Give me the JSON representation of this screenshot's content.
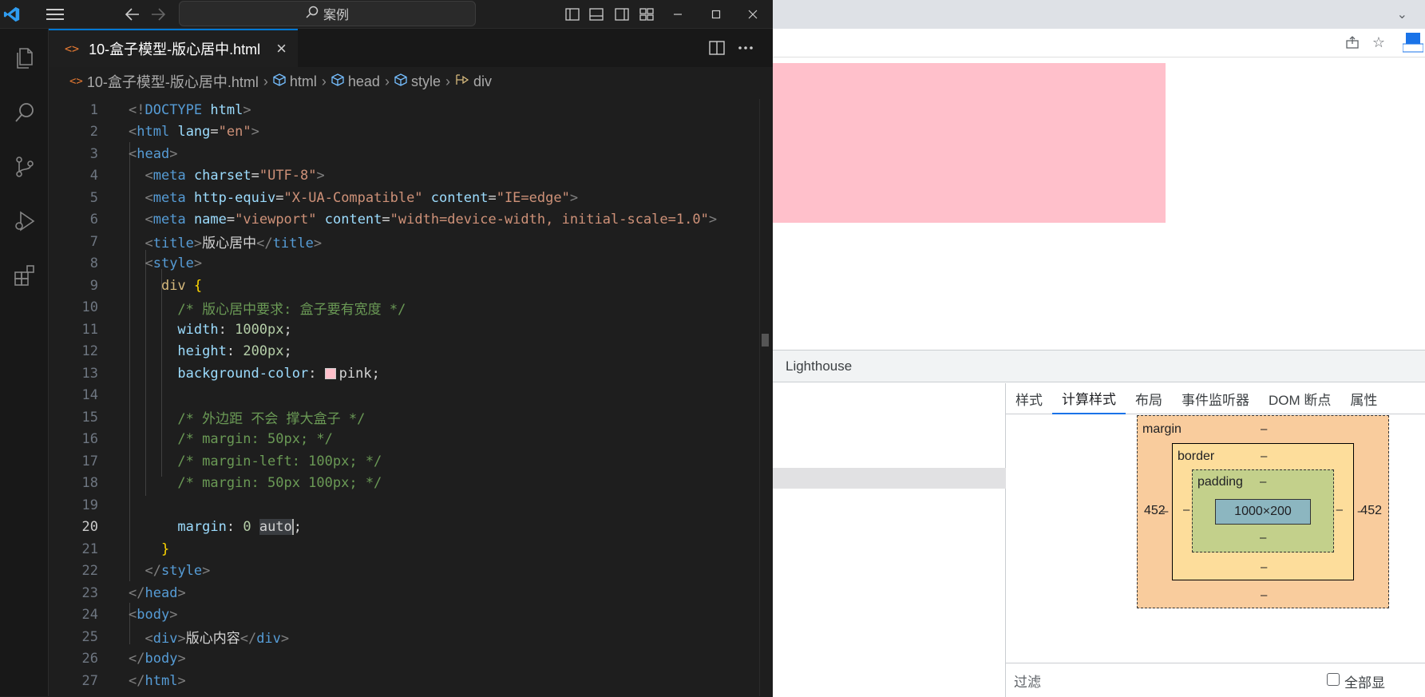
{
  "titlebar": {
    "search_label": "案例"
  },
  "editor": {
    "tab_title": "10-盒子模型-版心居中.html",
    "breadcrumb": {
      "file": "10-盒子模型-版心居中.html",
      "html": "html",
      "head": "head",
      "style": "style",
      "div": "div"
    },
    "code": {
      "l1_a": "<!",
      "l1_b": "DOCTYPE",
      "l1_c": " html",
      "l1_d": ">",
      "l2_tag": "html",
      "l2_attr": "lang",
      "l2_val": "\"en\"",
      "l3_tag": "head",
      "l4_tag": "meta",
      "l4_attr": "charset",
      "l4_val": "\"UTF-8\"",
      "l5_tag": "meta",
      "l5_attr1": "http-equiv",
      "l5_val1": "\"X-UA-Compatible\"",
      "l5_attr2": "content",
      "l5_val2": "\"IE=edge\"",
      "l6_tag": "meta",
      "l6_attr1": "name",
      "l6_val1": "\"viewport\"",
      "l6_attr2": "content",
      "l6_val2": "\"width=device-width, initial-scale=1.0\"",
      "l7_tag": "title",
      "l7_text": "版心居中",
      "l8_tag": "style",
      "l9_sel": "div",
      "l10": "/* 版心居中要求: 盒子要有宽度 */",
      "l11_prop": "width",
      "l11_val": "1000px",
      "l12_prop": "height",
      "l12_val": "200px",
      "l13_prop": "background-color",
      "l13_val": "pink",
      "l15": "/* 外边距 不会 撑大盒子 */",
      "l16": "/* margin: 50px; */",
      "l17": "/* margin-left: 100px; */",
      "l18": "/* margin: 50px 100px; */",
      "l20_prop": "margin",
      "l20_val1": "0",
      "l20_val2": "auto",
      "l22_tag": "style",
      "l23_tag": "head",
      "l24_tag": "body",
      "l25_tag": "div",
      "l25_text": "版心内容",
      "l26_tag": "body",
      "l27_tag": "html"
    },
    "line_numbers": [
      "1",
      "2",
      "3",
      "4",
      "5",
      "6",
      "7",
      "8",
      "9",
      "10",
      "11",
      "12",
      "13",
      "14",
      "15",
      "16",
      "17",
      "18",
      "19",
      "20",
      "21",
      "22",
      "23",
      "24",
      "25",
      "26",
      "27"
    ]
  },
  "devtools": {
    "top_tab": "Lighthouse",
    "tabs": [
      "样式",
      "计算样式",
      "布局",
      "事件监听器",
      "DOM 断点",
      "属性"
    ],
    "active_tab": "计算样式",
    "box_model": {
      "margin_label": "margin",
      "border_label": "border",
      "padding_label": "padding",
      "content": "1000×200",
      "margin_left": "452",
      "margin_right": "452",
      "dash": "–"
    },
    "filter_label": "过滤",
    "show_all_label": "全部显"
  },
  "colors": {
    "accent": "#0078d4",
    "pink": "#ffc0cb",
    "margin": "#f9cc9d",
    "border": "#fddd9b",
    "padding": "#c3d08b",
    "content": "#8cb6c0"
  }
}
